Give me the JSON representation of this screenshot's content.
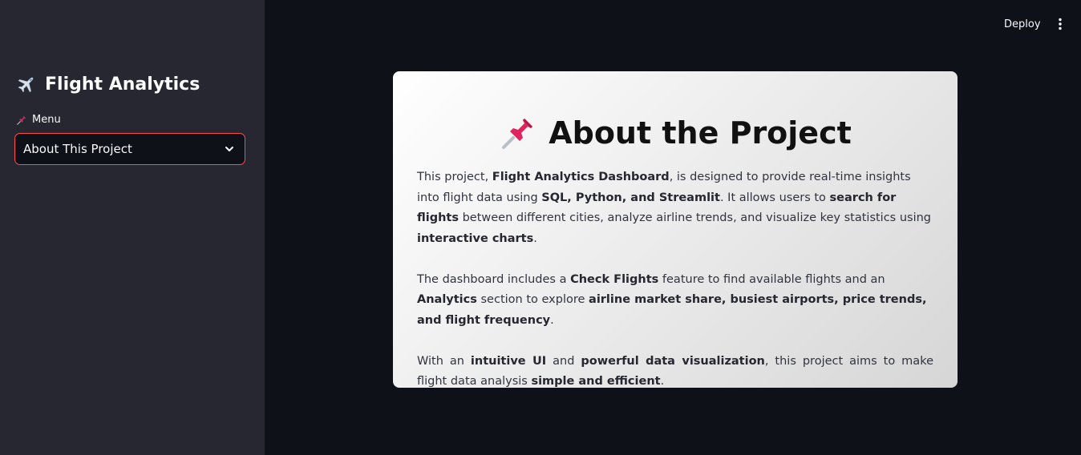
{
  "sidebar": {
    "title": "Flight Analytics",
    "menu_label": "Menu",
    "select_value": "About This Project"
  },
  "header": {
    "deploy_label": "Deploy"
  },
  "card": {
    "title": "About the Project",
    "p1": {
      "t1": "This project, ",
      "b1": "Flight Analytics Dashboard",
      "t2": ", is designed to provide real-time insights into flight data using ",
      "b2": "SQL, Python, and Streamlit",
      "t3": ". It allows users to ",
      "b3": "search for flights",
      "t4": " between different cities, analyze airline trends, and visualize key statistics using ",
      "b4": "interactive charts",
      "t5": "."
    },
    "p2": {
      "t1": "The dashboard includes a ",
      "b1": "Check Flights",
      "t2": " feature to find available flights and an ",
      "b2": "Analytics",
      "t3": " section to explore ",
      "b3": "airline market share, busiest airports, price trends, and flight frequency",
      "t4": "."
    },
    "p3": {
      "t1": "With an ",
      "b1": "intuitive UI",
      "t2": " and ",
      "b2": "powerful data visualization",
      "t3": ", this project aims to make flight data analysis ",
      "b3": "simple and efficient",
      "t4": "."
    }
  },
  "colors": {
    "background": "#0e1117",
    "sidebar": "#262730",
    "accent": "#ff4b4b",
    "text_light": "#fafafa",
    "text_dark": "#31333f"
  },
  "icons": {
    "sidebar_title": "airplane-icon",
    "menu": "pushpin-icon",
    "select": "chevron-down-icon",
    "header_menu": "kebab-icon",
    "card_title": "pushpin-icon"
  }
}
